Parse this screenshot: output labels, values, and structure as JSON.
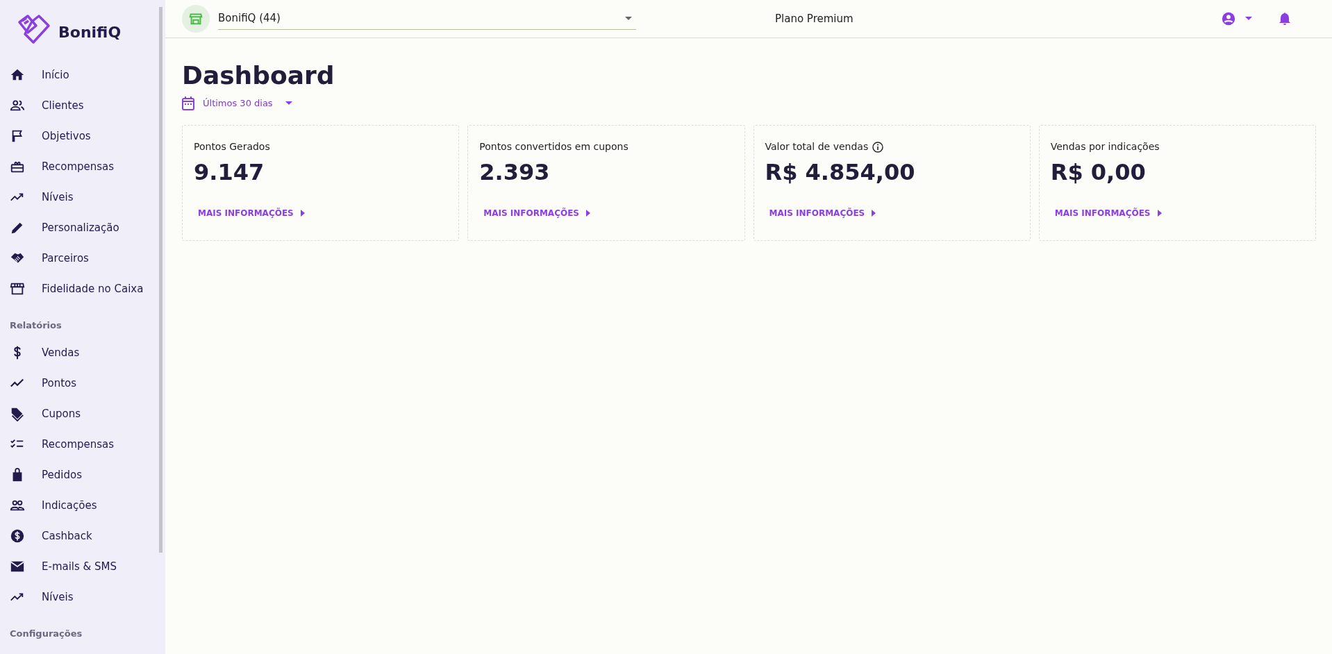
{
  "sidebar": {
    "logo_text": "BonifiQ",
    "sections": [
      {
        "items": [
          {
            "label": "Início"
          },
          {
            "label": "Clientes"
          },
          {
            "label": "Objetivos"
          },
          {
            "label": "Recompensas"
          },
          {
            "label": "Níveis"
          },
          {
            "label": "Personalização"
          },
          {
            "label": "Parceiros"
          },
          {
            "label": "Fidelidade no Caixa"
          }
        ]
      },
      {
        "heading": "Relatórios",
        "items": [
          {
            "label": "Vendas"
          },
          {
            "label": "Pontos"
          },
          {
            "label": "Cupons"
          },
          {
            "label": "Recompensas"
          },
          {
            "label": "Pedidos"
          },
          {
            "label": "Indicações"
          },
          {
            "label": "Cashback"
          },
          {
            "label": "E-mails & SMS"
          },
          {
            "label": "Níveis"
          }
        ]
      },
      {
        "heading": "Configurações"
      }
    ]
  },
  "topbar": {
    "store_select": {
      "value": "BonifiQ (44)"
    },
    "plan": "Plano Premium"
  },
  "page": {
    "title": "Dashboard",
    "period": "Últimos 30 dias"
  },
  "cards": [
    {
      "title": "Pontos Gerados",
      "info": false,
      "value": "9.147",
      "link": "MAIS INFORMAÇÕES"
    },
    {
      "title": "Pontos convertidos em cupons",
      "info": false,
      "value": "2.393",
      "link": "MAIS INFORMAÇÕES"
    },
    {
      "title": "Valor total de vendas",
      "info": true,
      "value": "R$ 4.854,00",
      "link": "MAIS INFORMAÇÕES"
    },
    {
      "title": "Vendas por indicações",
      "info": false,
      "value": "R$ 0,00",
      "link": "MAIS INFORMAÇÕES"
    }
  ]
}
